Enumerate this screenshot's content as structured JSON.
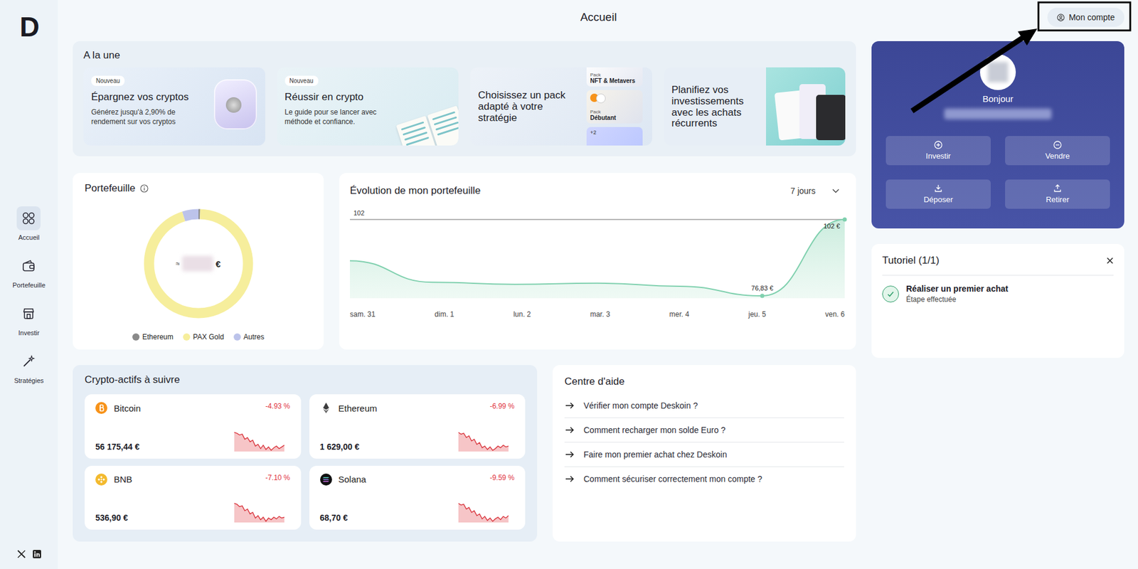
{
  "header": {
    "title": "Accueil",
    "account_button": "Mon compte"
  },
  "sidebar": {
    "logo": "D",
    "items": [
      {
        "label": "Accueil",
        "selected": true
      },
      {
        "label": "Portefeuille",
        "selected": false
      },
      {
        "label": "Investir",
        "selected": false
      },
      {
        "label": "Stratégies",
        "selected": false
      }
    ]
  },
  "featured": {
    "title": "A la une",
    "cards": [
      {
        "kind": "piggy",
        "badge": "Nouveau",
        "title": "Épargnez vos cryptos",
        "text": "Générez jusqu'à 2,90% de rendement sur vos cryptos"
      },
      {
        "kind": "guide",
        "badge": "Nouveau",
        "title": "Réussir en crypto",
        "text": "Le guide pour se lancer avec méthode et confiance."
      },
      {
        "kind": "packs",
        "badge": "",
        "title": "Choisissez un pack adapté à votre stratégie",
        "text": "",
        "packs": [
          {
            "label": "Pack",
            "name": "NFT & Metavers"
          },
          {
            "label": "Pack",
            "name": "Débutant"
          }
        ],
        "more": "+2"
      },
      {
        "kind": "wallet",
        "badge": "",
        "title": "Planifiez vos investissements avec les achats récurrents",
        "text": ""
      }
    ]
  },
  "profile": {
    "greeting": "Bonjour",
    "actions": [
      {
        "label": "Investir"
      },
      {
        "label": "Vendre"
      },
      {
        "label": "Déposer"
      },
      {
        "label": "Retirer"
      }
    ]
  },
  "tutorial": {
    "title": "Tutoriel (1/1)",
    "steps": [
      {
        "label": "Réaliser un premier achat",
        "status": "Étape effectuée",
        "checked": true
      }
    ]
  },
  "portfolio": {
    "title": "Portefeuille",
    "approx": "≈",
    "currency": "€",
    "legend": [
      {
        "label": "Ethereum",
        "color": "#8a8a8a",
        "share": 0.005
      },
      {
        "label": "PAX Gold",
        "color": "#f6ee9c",
        "share": 0.945
      },
      {
        "label": "Autres",
        "color": "#bcc3ea",
        "share": 0.05
      }
    ]
  },
  "evolution": {
    "title": "Évolution de mon portefeuille",
    "period": "7 jours",
    "axis_top": "102",
    "x_labels": [
      "sam. 31",
      "dim. 1",
      "lun. 2",
      "mar. 3",
      "mer. 4",
      "jeu. 5",
      "ven. 6"
    ],
    "values": [
      88.4,
      81.3,
      80.6,
      81.0,
      80.0,
      76.83,
      102
    ],
    "points": [
      {
        "index": 5,
        "label": "76,83 €"
      },
      {
        "index": 6,
        "label": "102 €"
      }
    ]
  },
  "watchlist": {
    "title": "Crypto-actifs à suivre",
    "assets": [
      {
        "kind": "btc",
        "name": "Bitcoin",
        "change": "-4.93 %",
        "price": "56 175,44 €",
        "values": [
          30,
          29,
          27,
          28,
          22,
          24,
          19,
          21,
          14,
          16,
          11,
          15,
          10,
          13,
          9,
          12,
          14,
          11,
          13,
          15
        ]
      },
      {
        "kind": "eth",
        "name": "Ethereum",
        "change": "-6.99 %",
        "price": "1 629,00 €",
        "values": [
          30,
          28,
          29,
          24,
          26,
          20,
          22,
          16,
          18,
          12,
          14,
          10,
          13,
          9,
          11,
          14,
          12,
          15,
          13,
          14
        ]
      },
      {
        "kind": "bnb",
        "name": "BNB",
        "change": "-7.10 %",
        "price": "536,90 €",
        "values": [
          30,
          29,
          26,
          27,
          21,
          23,
          17,
          19,
          12,
          15,
          10,
          13,
          8,
          12,
          10,
          13,
          11,
          14,
          12,
          13
        ]
      },
      {
        "kind": "sol",
        "name": "Solana",
        "change": "-9.59 %",
        "price": "68,70 €",
        "values": [
          30,
          28,
          29,
          23,
          25,
          19,
          21,
          15,
          17,
          11,
          14,
          9,
          12,
          8,
          11,
          13,
          10,
          14,
          12,
          15
        ]
      }
    ]
  },
  "help": {
    "title": "Centre d'aide",
    "links": [
      "Vérifier mon compte Deskoin ?",
      "Comment recharger mon solde Euro ?",
      "Faire mon premier achat chez Deskoin",
      "Comment sécuriser correctement mon compte ?"
    ]
  }
}
